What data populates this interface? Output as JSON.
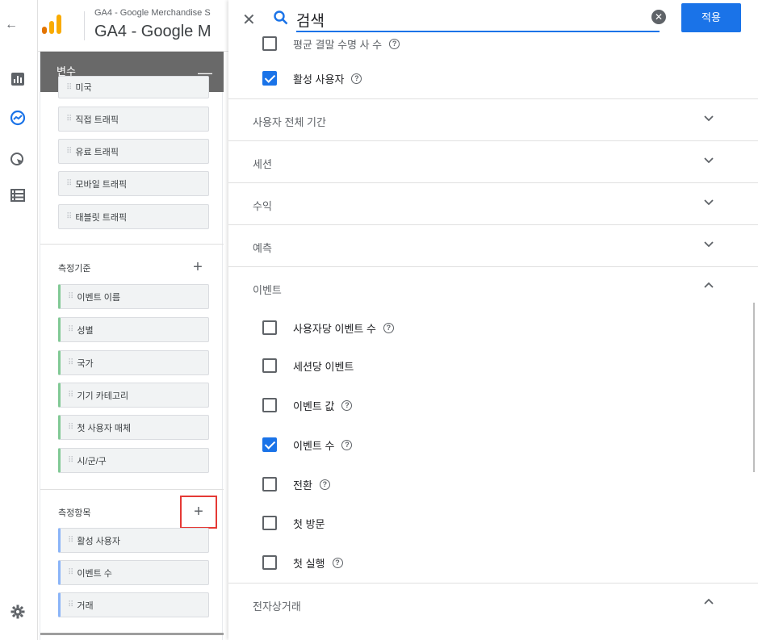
{
  "header": {
    "property_sub": "GA4 - Google Merchandise S",
    "property_main": "GA4 - Google M"
  },
  "variables": {
    "title": "변수",
    "segments": [
      "미국",
      "직접 트래픽",
      "유료 트래픽",
      "모바일 트래픽",
      "태블릿 트래픽"
    ],
    "dimensions_label": "측정기준",
    "dimensions": [
      "이벤트 이름",
      "성별",
      "국가",
      "기기 카테고리",
      "첫 사용자 매체",
      "시/군/구"
    ],
    "metrics_label": "측정항목",
    "metrics": [
      "활성 사용자",
      "이벤트 수",
      "거래"
    ]
  },
  "picker": {
    "search_value": "검색",
    "apply_label": "적용",
    "top_partial_item": "평균 결말 수명 사 수",
    "active_users_item": "활성 사용자",
    "categories": [
      {
        "label": "사용자 전체 기간",
        "expanded": false
      },
      {
        "label": "세션",
        "expanded": false
      },
      {
        "label": "수익",
        "expanded": false
      },
      {
        "label": "예측",
        "expanded": false
      },
      {
        "label": "이벤트",
        "expanded": true
      },
      {
        "label": "전자상거래",
        "expanded": true
      }
    ],
    "event_items": [
      {
        "label": "사용자당 이벤트 수",
        "checked": false,
        "help": true
      },
      {
        "label": "세션당 이벤트",
        "checked": false,
        "help": false
      },
      {
        "label": "이벤트 값",
        "checked": false,
        "help": true
      },
      {
        "label": "이벤트 수",
        "checked": true,
        "help": true
      },
      {
        "label": "전환",
        "checked": false,
        "help": true
      },
      {
        "label": "첫 방문",
        "checked": false,
        "help": false
      },
      {
        "label": "첫 실행",
        "checked": false,
        "help": true
      }
    ]
  },
  "colors": {
    "accent": "#1a73e8",
    "header_bar": "#696969",
    "highlight": "#e53935",
    "dimension_chip": "#81c995",
    "metric_chip": "#8ab4f8"
  }
}
